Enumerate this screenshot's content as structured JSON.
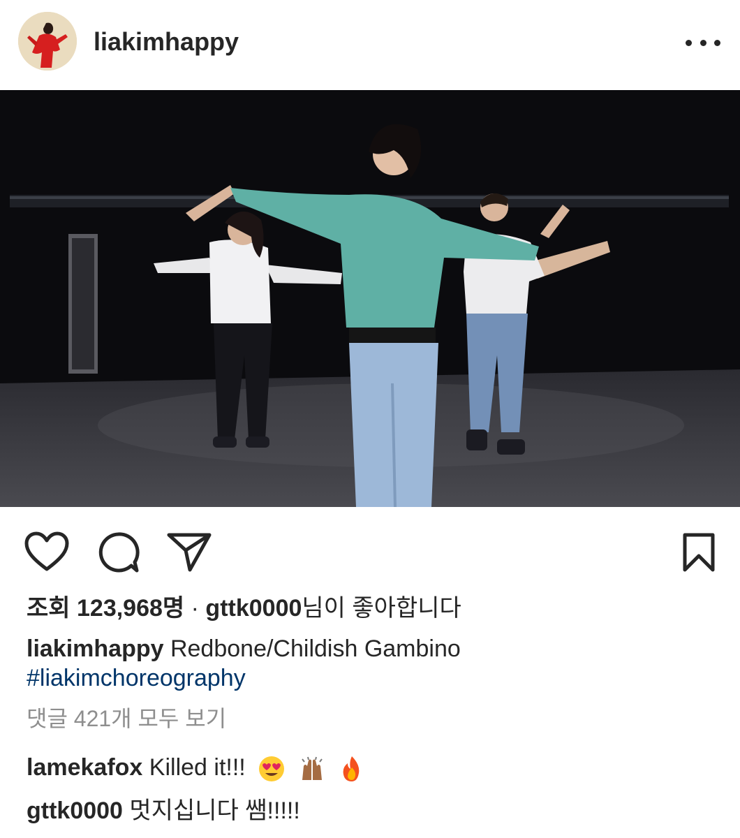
{
  "post": {
    "username": "liakimhappy",
    "views_label": "조회 123,968명",
    "liked_by_user": "gttk0000",
    "liked_suffix": "님이 좋아합니다",
    "separator": "·",
    "caption_user": "liakimhappy",
    "caption_text": "Redbone/Childish Gambino",
    "hashtag": "#liakimchoreography",
    "view_all_comments": "댓글 421개 모두 보기",
    "comments": [
      {
        "user": "lamekafox",
        "text": "Killed it!!!",
        "emojis": [
          "heart-eyes-emoji",
          "raised-hands-emoji",
          "fire-emoji"
        ]
      },
      {
        "user": "gttk0000",
        "text": "멋지십니다 쌤!!!!!"
      }
    ]
  },
  "icons": [
    "more-options-icon",
    "heart-icon",
    "comment-icon",
    "share-icon",
    "bookmark-icon"
  ],
  "colors": {
    "text": "#262626",
    "hashtag": "#003569",
    "secondary": "#8e8e8e",
    "media_bg": "#0b0b0e"
  }
}
